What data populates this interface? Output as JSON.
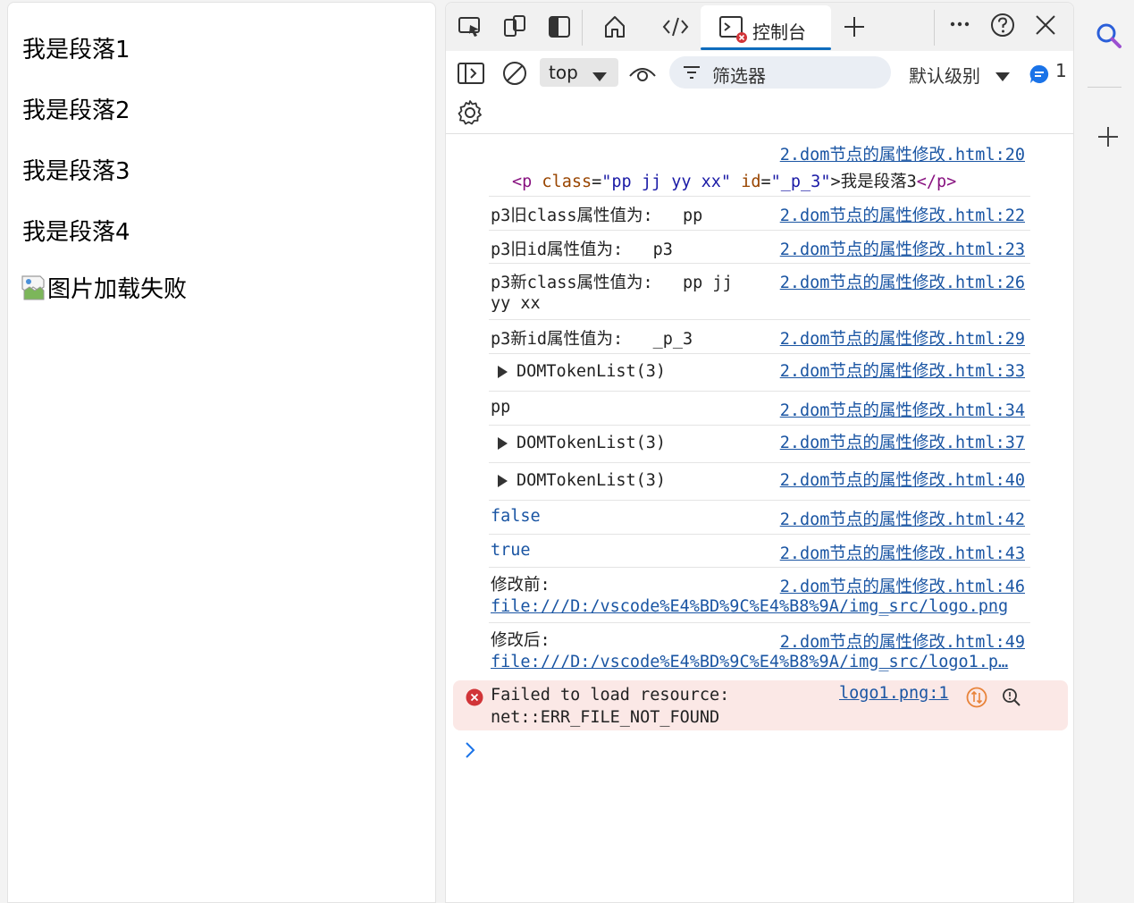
{
  "page": {
    "paragraphs": [
      "我是段落1",
      "我是段落2",
      "我是段落3",
      "我是段落4"
    ],
    "image_alt": "图片加载失败"
  },
  "devtools": {
    "tabs": {
      "console_label": "控制台"
    },
    "toolbar": {
      "context": "top",
      "filter_placeholder": "筛选器",
      "level": "默认级别",
      "message_count": "1"
    },
    "console": {
      "first_source": "2.dom节点的属性修改.html:20",
      "element": {
        "tag_open": "<p",
        "class_attr": "class",
        "class_val": "\"pp jj yy xx\"",
        "id_attr": "id",
        "id_val": "\"_p_3\"",
        "text": ">我是段落3",
        "tag_close": "</p>"
      },
      "rows": [
        {
          "msg": "p3旧class属性值为:   pp",
          "source": "2.dom节点的属性修改.html:22"
        },
        {
          "msg": "p3旧id属性值为:   p3",
          "source": "2.dom节点的属性修改.html:23"
        },
        {
          "msg": "p3新class属性值为:   pp jj",
          "msg2": "yy xx",
          "source": "2.dom节点的属性修改.html:26"
        },
        {
          "msg": "p3新id属性值为:   _p_3",
          "source": "2.dom节点的属性修改.html:29"
        },
        {
          "msg": "DOMTokenList(3)",
          "source": "2.dom节点的属性修改.html:33"
        },
        {
          "msg": "pp",
          "source": "2.dom节点的属性修改.html:34"
        },
        {
          "msg": "DOMTokenList(3)",
          "source": "2.dom节点的属性修改.html:37"
        },
        {
          "msg": "DOMTokenList(3)",
          "source": "2.dom节点的属性修改.html:40"
        },
        {
          "msg": "false",
          "source": "2.dom节点的属性修改.html:42"
        },
        {
          "msg": "true",
          "source": "2.dom节点的属性修改.html:43"
        },
        {
          "msg": "修改前:",
          "link": "file:///D:/vscode%E4%BD%9C%E4%B8%9A/img_src/logo.png",
          "source": "2.dom节点的属性修改.html:46"
        },
        {
          "msg": "修改后:",
          "link": "file:///D:/vscode%E4%BD%9C%E4%B8%9A/img_src/logo1.p…",
          "source": "2.dom节点的属性修改.html:49"
        }
      ],
      "error": {
        "line1": "Failed to load resource:",
        "line2": "net::ERR_FILE_NOT_FOUND",
        "source": "logo1.png:1"
      }
    }
  },
  "colors": {
    "link": "#1a55a3",
    "accent": "#0f6cbd",
    "error_bg": "#fbe8e6",
    "error_icon": "#d13438"
  }
}
